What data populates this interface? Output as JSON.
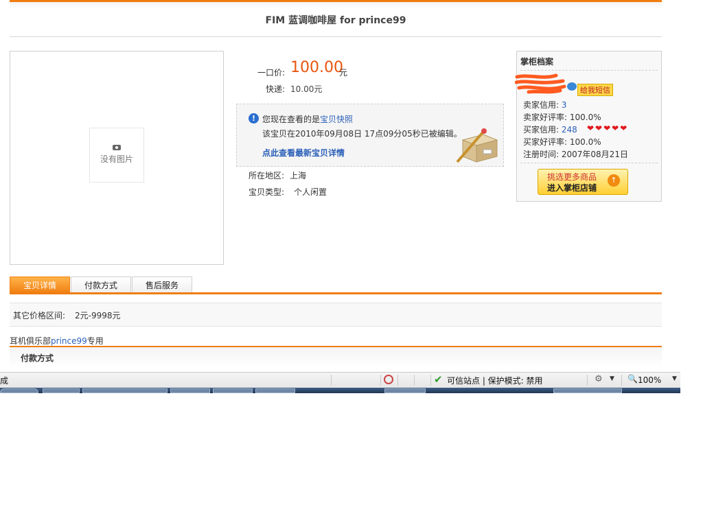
{
  "header": {
    "title": "FIM 蓝调咖啡屋  for prince99"
  },
  "image": {
    "placeholder_text": "没有图片"
  },
  "pricing": {
    "price_label": "一口价:",
    "price_value": "100.00",
    "price_unit": "元",
    "shipping_label": "快递:",
    "shipping_value": "10.00元"
  },
  "snapshot": {
    "line1_prefix": "您现在查看的是",
    "line1_link": "宝贝快照",
    "line2": "该宝贝在2010年09月08日  17点09分05秒已被编辑。",
    "view_latest": "点此查看最新宝贝详情"
  },
  "item": {
    "region_label": "所在地区:",
    "region_value": "上海",
    "type_label": "宝贝类型:",
    "type_value": "个人闲置"
  },
  "seller": {
    "title": "掌柜档案",
    "send_message": "给我短信",
    "seller_credit_label": "卖家信用:",
    "seller_credit_value": "3",
    "seller_rate_label": "卖家好评率:",
    "seller_rate_value": "100.0%",
    "buyer_credit_label": "买家信用:",
    "buyer_credit_value": "248",
    "hearts": "❤❤❤❤❤",
    "buyer_rate_label": "买家好评率:",
    "buyer_rate_value": "100.0%",
    "register_label": "注册时间:",
    "register_value": "2007年08月21日",
    "shop_button_line1": "挑选更多商品",
    "shop_button_line2": "进入掌柜店铺"
  },
  "tabs": [
    {
      "label": "宝贝详情",
      "active": true
    },
    {
      "label": "付款方式",
      "active": false
    },
    {
      "label": "售后服务",
      "active": false
    }
  ],
  "details": {
    "price_range_label": "其它价格区间:",
    "price_range_value": "2元-9998元",
    "club_prefix": "耳机俱乐部",
    "club_link": "prince99",
    "club_suffix": "专用",
    "section_title": "付款方式"
  },
  "statusbar": {
    "status": "成",
    "trusted": "可信站点 | 保护模式: 禁用",
    "zoom": "100%"
  },
  "colors": {
    "accent": "#f07d10",
    "price": "#e8560e",
    "link": "#2a5fb8"
  }
}
